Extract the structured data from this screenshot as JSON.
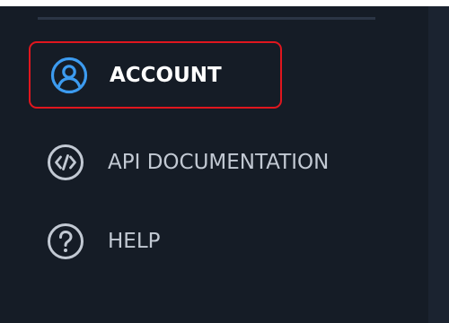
{
  "sidebar": {
    "items": [
      {
        "label": "ACCOUNT",
        "icon": "user-circle-icon",
        "active": true
      },
      {
        "label": "API DOCUMENTATION",
        "icon": "code-circle-icon",
        "active": false
      },
      {
        "label": "HELP",
        "icon": "question-circle-icon",
        "active": false
      }
    ]
  },
  "colors": {
    "background": "#151c26",
    "active_icon": "#3c9bf0",
    "active_border": "#e0161e",
    "inactive_text": "#c2c9d3",
    "inactive_icon": "#c2c9d3"
  }
}
